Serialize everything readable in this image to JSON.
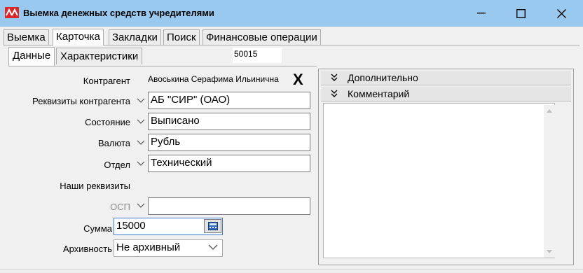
{
  "window": {
    "title": "Выемка денежных средств учредителями",
    "controls": [
      "minimize",
      "maximize",
      "close"
    ]
  },
  "tabs": [
    {
      "label": "Выемка",
      "active": false
    },
    {
      "label": "Карточка",
      "active": true
    },
    {
      "label": "Закладки",
      "active": false
    },
    {
      "label": "Поиск",
      "active": false
    },
    {
      "label": "Финансовые операции",
      "active": false
    }
  ],
  "subtabs": [
    {
      "label": "Данные",
      "active": true
    },
    {
      "label": "Характеристики",
      "active": false
    }
  ],
  "record_id": "50015",
  "form": {
    "counterparty_label": "Контрагент",
    "counterparty_value": "Авоськина Серафима Ильинична",
    "clear_label": "X",
    "requisites_label": "Реквизиты контрагента",
    "requisites_value": "АБ \"СИР\" (ОАО)",
    "state_label": "Состояние",
    "state_value": "Выписано",
    "currency_label": "Валюта",
    "currency_value": "Рубль",
    "department_label": "Отдел",
    "department_value": "Технический",
    "our_requisites_label": "Наши реквизиты",
    "osp_label": "ОСП",
    "osp_value": "",
    "sum_label": "Сумма",
    "sum_value": "15000",
    "archive_label": "Архивность",
    "archive_value": "Не архивный"
  },
  "right_panel": {
    "additional_label": "Дополнительно",
    "comment_label": "Комментарий",
    "comment_value": ""
  },
  "colors": {
    "titlebar": "#99c9ef",
    "icon_red": "#d8262a",
    "focus_border": "#3a7bd5"
  }
}
